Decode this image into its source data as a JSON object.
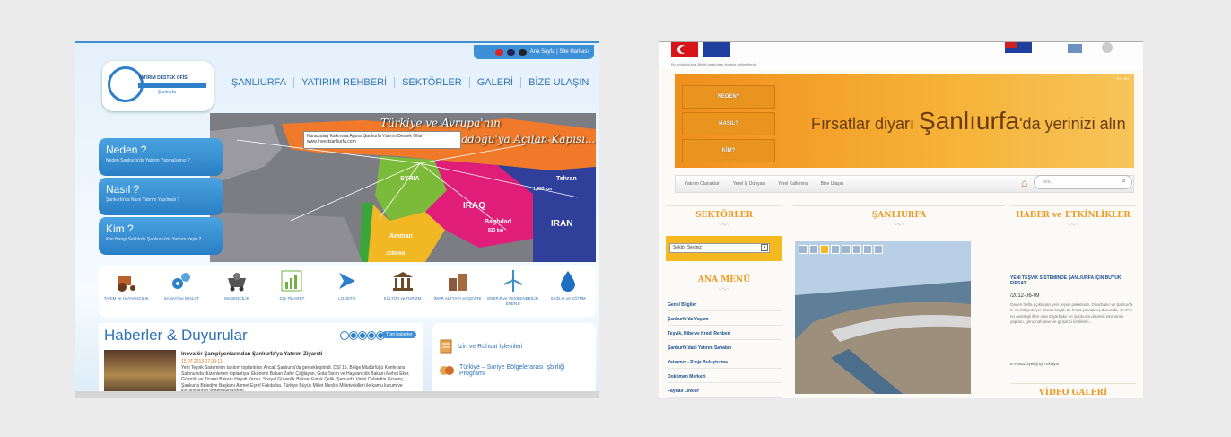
{
  "left_site": {
    "topbar": {
      "links": "Ana Sayfa | Site Haritası"
    },
    "logo": {
      "line1": "YATIRIM DESTEK OFİSİ",
      "line2": "Şanlıurfa"
    },
    "nav": [
      "ŞANLIURFA",
      "YATIRIM REHBERİ",
      "SEKTÖRLER",
      "GALERİ",
      "BİZE ULAŞIN"
    ],
    "side_buttons": [
      {
        "title": "Neden ?",
        "subtitle": "Neden Şanlıurfa'da Yatırım Yapmalısınız ?"
      },
      {
        "title": "Nasıl ?",
        "subtitle": "Şanlıurfa'da Nasıl Yatırım Yapılmalı ?"
      },
      {
        "title": "Kim ?",
        "subtitle": "Kim Hangi Sektörde Şanlıurfa'da Yatırım Yaptı ?"
      }
    ],
    "map": {
      "title_line1": "Türkiye ve Avrupa'nın",
      "title_line2": "adoğu'ya Açılan Kapısı...",
      "tooltip_line1": "Karacadağ Kalkınma Ajansı Şanlıurfa Yatırım Destek Ofisi",
      "tooltip_line2": "www.investsanliurfa.com",
      "labels": {
        "syria": "SYRIA",
        "iraq": "IRAQ",
        "iran": "IRAN",
        "tehran": "Tehran",
        "baghdad": "Baghdad",
        "amman": "Amman",
        "jordan": "JORDAN",
        "dist1": "1,233 km",
        "dist2": "823 km"
      }
    },
    "sectors": [
      {
        "label": "TARIM ve HAYVANCILIK",
        "icon": "tractor-icon",
        "color": "#b8622a"
      },
      {
        "label": "SANAYİ ve İMALAT",
        "icon": "gears-icon",
        "color": "#2c7fc8"
      },
      {
        "label": "MADENCİLİK",
        "icon": "mine-cart-icon",
        "color": "#555555"
      },
      {
        "label": "DIŞ TİCARET",
        "icon": "chart-icon",
        "color": "#6fb13c"
      },
      {
        "label": "LOJİSTİK",
        "icon": "plane-icon",
        "color": "#2c7fc8"
      },
      {
        "label": "KÜLTÜR ve TURİZM",
        "icon": "museum-icon",
        "color": "#6b4b2a"
      },
      {
        "label": "İMAR ALTYAPI ve ÇEVRE",
        "icon": "buildings-icon",
        "color": "#8a5a3a"
      },
      {
        "label": "ENERJİ ve YENİLENEBİLİR ENERJİ",
        "icon": "wind-turbine-icon",
        "color": "#3a8fc8"
      },
      {
        "label": "SAĞLIK ve EĞİTİM",
        "icon": "drop-icon",
        "color": "#1f6fc0"
      }
    ],
    "news": {
      "heading": "Haberler & Duyurular",
      "all_news": "Tüm haberler",
      "item_title": "Inovatör Şampiyonlarından Şanlıurfa'ya Yatırım Ziyareti",
      "item_date": "15.07.2013 07:39:11",
      "item_body": "Yeni Teşvik Sisteminin tanıtım toplantıları Ancak Şanlıurfa'da gerçekleştirildi. DSİ 15. Bölge Müdürlüğü Konferans Salonu'nda düzenlenen toplantıya, Ekonomi Bakan Zafer Çağlayan, Gıda Tarım ve Hayvancılık Bakanı Mehdi Eker, Gümrük ve Ticaret Bakanı Hayati Yazıcı, Sosyal Güvenlik Bakanı Faruk Çelik, Şanlıurfa Valisi Celalettin Güvenç, Şanlıurfa Belediye Başkanı Ahmet Eşref Fakıbaba, Türkiye Büyük Millet Meclisi Milletvekilleri ile kamu kurum ve kuruluşlarının yöneticileri katıldı."
    },
    "links": [
      {
        "label": "İzin ve Ruhsat İşlemleri",
        "icon": "document-icon"
      },
      {
        "label": "Türkiye – Suriye Bölgelerarası İşbirliği Programı",
        "icon": "handshake-icon"
      }
    ]
  },
  "right_site": {
    "motto": "Bu proje Avrupa Birliği tarafından finanse edilmektedir.",
    "banner": {
      "buttons": [
        "NEDEN?",
        "NASIL?",
        "KİM?"
      ],
      "tagline_pre": "Fırsatlar diyarı",
      "tagline_city": "Şanlıurfa",
      "tagline_post": "'da yerinizi alın",
      "page_indicator": "TR | EN"
    },
    "navbar": [
      "Yatırım Olanakları",
      "Yerel İş Dünyası",
      "Yerel Kalkınma",
      "Bize Ulaşın"
    ],
    "search_placeholder": "ara...",
    "sections": {
      "sectors": "SEKTÖRLER",
      "city": "ŞANLIURFA",
      "news": "HABER ve ETKİNLİKLER",
      "menu": "ANA MENÜ",
      "video": "VİDEO GALERİ"
    },
    "sector_select": "Sektör Seçiniz",
    "menu_items": [
      "Genel Bilgiler",
      "Şanlıurfa'da Yaşam",
      "Teşvik, Hibe ve Kredi Rehberi",
      "Şanlıurfa'daki Yatırım Sahaları",
      "Yatırımcı - Proje Buluşturma",
      "Doküman Merkezi",
      "Faydalı Linkler"
    ],
    "news": {
      "title": "YENİ TEŞVİK SİSTEMİNDE ŞANLIURFA İÇİN BÜYÜK FIRSAT",
      "date": "/2012-06-09",
      "body": "Geçen hafta açıklanan yeni teşvik paketinde, Diyarbakır ve Şanlıurfa 6. no bölgede yer alarak büyük bir fırsat yakalamış durumda. GAP'ın en avantajlı illeri olan Diyarbakır ve Şanlıurfa dinamik ekonomik yapıları, genç nüfusları ve girişimci kimlikleri...",
      "more": "E-Posta Üyeliği için tıklayın"
    }
  },
  "colors": {
    "left_accent": "#2c7fc8",
    "right_accent": "#f6b81f",
    "right_heading": "#ec9b25"
  }
}
